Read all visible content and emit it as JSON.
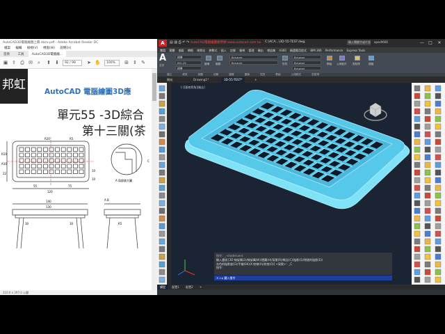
{
  "pdf": {
    "title": "AutoCAD3D電腦繪圖上冊.docx.pdf - Adobe Acrobat Reader DC",
    "menu": [
      "檔案",
      "編輯",
      "檢視(V)",
      "視窗(W)",
      "說明(H)"
    ],
    "tabs": [
      "首頁",
      "工具",
      "AutoCAD3D電腦繪..."
    ],
    "page_input": "92 / 99",
    "zoom": "100%",
    "logo_text": "邦虹",
    "header": "AutoCAD 電腦繪圖3D應",
    "title_line1": "單元55 -3D綜合",
    "title_line2": "第十三關(茶",
    "status": "210.0 x 297.0 公釐",
    "dims": [
      "R10",
      "R20",
      "R5",
      "A10",
      "120",
      "22",
      "55",
      "75",
      "10",
      "10",
      "30",
      "30",
      "140",
      "130",
      "R5",
      "A B",
      "A 局部放大圖",
      "C"
    ]
  },
  "acad": {
    "logo": "A",
    "title_notice": "AutoCAD電腦繪圖教學網 www.autocad.com.tw",
    "filename": "C:\\ACA...\\3D-55-TEST.dwg",
    "search_placeholder": "輸入關鍵字或片語",
    "user": "apex9666",
    "win_buttons": [
      "—",
      "□",
      "✕"
    ],
    "ribbon_tabs": [
      "常用",
      "實體",
      "曲面",
      "網格",
      "視覺化",
      "參數式",
      "插入",
      "註解",
      "檢視",
      "管理",
      "輸出",
      "增益集",
      "A360",
      "精選應用程式",
      "BIM 360",
      "Performance",
      "Express Tools"
    ],
    "active_ribbon_tab": "常用",
    "ribbon": {
      "group_label": "文字",
      "style_combo": "標準",
      "dim_combo": "ISO-25",
      "layer_combo": "ByLayer",
      "table_combo": "標準",
      "layer_name": "ByLayer",
      "labels": [
        "圖塊",
        "圖層",
        "性質",
        "群組",
        "公用程式",
        "剪貼簿",
        "視圖"
      ]
    },
    "panel_labels": [
      "建立",
      "修改",
      "繪圖",
      "註解",
      "圖層",
      "圖塊",
      "性質",
      "群組",
      "公用程式",
      "剪貼簿"
    ],
    "doc_tabs": [
      "開始",
      "Drawing1*",
      "3D-55-TEST*"
    ],
    "active_doc_tab": "3D-55-TEST*",
    "viewport_label": "[-][東南等角][概念]",
    "command_history": [
      "指令：_-shaderuent",
      "輸入選項 [3D 線架構(2)/線架構(W)/隱藏(H)/寫實(R)/概念(C)/陰影(S)/帶邊的陰影(E)/",
      "灰色的陰影度(G)/手繪(SK)/X 射線(X)/其他(O)] <寫實>：_C",
      "指令："
    ],
    "command_input": "鍵入指令",
    "layout_tabs": [
      "模型",
      "配置1",
      "配置2"
    ],
    "active_layout_tab": "模型"
  },
  "colors": {
    "acad_bg": "#1b2433",
    "model_top": "#56c9ea",
    "model_side": "#7fe2f6",
    "model_edge": "#bdf2ff",
    "grid_dark": "#0e1a2a",
    "command_bar": "#1f3f9e"
  }
}
